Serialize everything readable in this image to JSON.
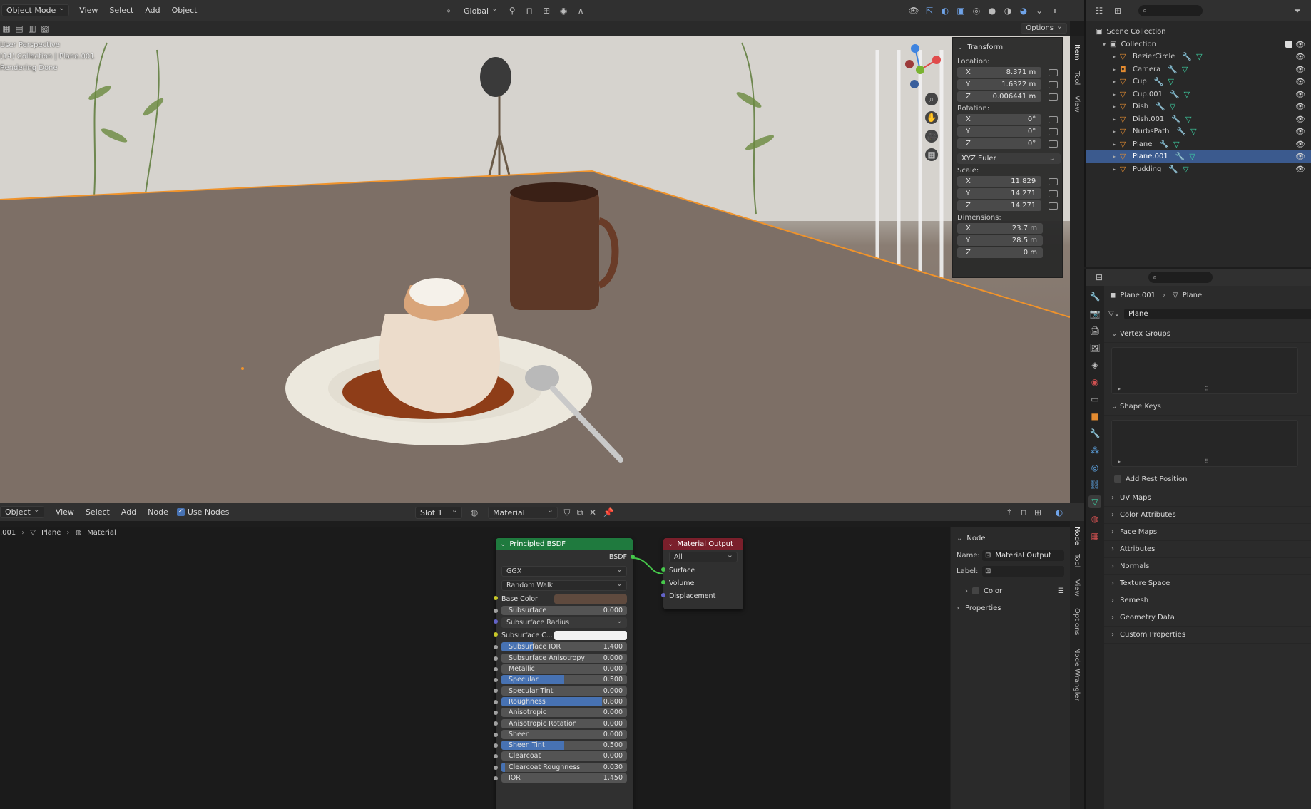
{
  "top_header": {
    "mode": "Object Mode",
    "menus": [
      "View",
      "Select",
      "Add",
      "Object"
    ],
    "orientation": "Global"
  },
  "viewport": {
    "options_label": "Options",
    "overlay_lines": [
      "User Perspective",
      "(14) Collection | Plane.001",
      "Rendering Done"
    ]
  },
  "npanel": {
    "tabs": [
      "Item",
      "Tool",
      "View"
    ],
    "section": "Transform",
    "location_label": "Location:",
    "location": [
      {
        "axis": "X",
        "value": "8.371 m"
      },
      {
        "axis": "Y",
        "value": "1.6322 m"
      },
      {
        "axis": "Z",
        "value": "0.006441 m"
      }
    ],
    "rotation_label": "Rotation:",
    "rotation": [
      {
        "axis": "X",
        "value": "0°"
      },
      {
        "axis": "Y",
        "value": "0°"
      },
      {
        "axis": "Z",
        "value": "0°"
      }
    ],
    "rotation_mode": "XYZ Euler",
    "scale_label": "Scale:",
    "scale": [
      {
        "axis": "X",
        "value": "11.829"
      },
      {
        "axis": "Y",
        "value": "14.271"
      },
      {
        "axis": "Z",
        "value": "14.271"
      }
    ],
    "dimensions_label": "Dimensions:",
    "dimensions": [
      {
        "axis": "X",
        "value": "23.7 m"
      },
      {
        "axis": "Y",
        "value": "28.5 m"
      },
      {
        "axis": "Z",
        "value": "0 m"
      }
    ]
  },
  "outliner": {
    "scene_collection": "Scene Collection",
    "collection": "Collection",
    "items": [
      {
        "name": "BezierCircle",
        "selected": false
      },
      {
        "name": "Camera",
        "selected": false
      },
      {
        "name": "Cup",
        "selected": false
      },
      {
        "name": "Cup.001",
        "selected": false
      },
      {
        "name": "Dish",
        "selected": false
      },
      {
        "name": "Dish.001",
        "selected": false
      },
      {
        "name": "NurbsPath",
        "selected": false
      },
      {
        "name": "Plane",
        "selected": false
      },
      {
        "name": "Plane.001",
        "selected": true
      },
      {
        "name": "Pudding",
        "selected": false
      }
    ]
  },
  "properties": {
    "breadcrumb_object": "Plane.001",
    "breadcrumb_data": "Plane",
    "mesh_name": "Plane",
    "sections": {
      "vertex_groups": "Vertex Groups",
      "shape_keys": "Shape Keys",
      "add_rest_position": "Add Rest Position",
      "collapsed": [
        "UV Maps",
        "Color Attributes",
        "Face Maps",
        "Attributes",
        "Normals",
        "Texture Space",
        "Remesh",
        "Geometry Data",
        "Custom Properties"
      ]
    }
  },
  "node_header": {
    "mode": "Object",
    "menus": [
      "View",
      "Select",
      "Add",
      "Node"
    ],
    "use_nodes": "Use Nodes",
    "slot": "Slot 1",
    "material": "Material",
    "breadcrumb": [
      ".001",
      "Plane",
      "Material"
    ]
  },
  "bsdf_node": {
    "title": "Principled BSDF",
    "output": "BSDF",
    "distribution": "GGX",
    "subsurface_method": "Random Walk",
    "base_color_label": "Base Color",
    "subsurface_radius": "Subsurface Radius",
    "subsurface_color_label": "Subsurface C...",
    "sliders": [
      {
        "label": "Subsurface",
        "value": "0.000",
        "fill": 0
      },
      {
        "label": "Subsurface IOR",
        "value": "1.400",
        "fill": 0.25
      },
      {
        "label": "Subsurface Anisotropy",
        "value": "0.000",
        "fill": 0
      },
      {
        "label": "Metallic",
        "value": "0.000",
        "fill": 0
      },
      {
        "label": "Specular",
        "value": "0.500",
        "fill": 0.5
      },
      {
        "label": "Specular Tint",
        "value": "0.000",
        "fill": 0
      },
      {
        "label": "Roughness",
        "value": "0.800",
        "fill": 0.8
      },
      {
        "label": "Anisotropic",
        "value": "0.000",
        "fill": 0
      },
      {
        "label": "Anisotropic Rotation",
        "value": "0.000",
        "fill": 0
      },
      {
        "label": "Sheen",
        "value": "0.000",
        "fill": 0
      },
      {
        "label": "Sheen Tint",
        "value": "0.500",
        "fill": 0.5
      },
      {
        "label": "Clearcoat",
        "value": "0.000",
        "fill": 0
      },
      {
        "label": "Clearcoat Roughness",
        "value": "0.030",
        "fill": 0.03
      },
      {
        "label": "IOR",
        "value": "1.450",
        "fill": 0
      }
    ]
  },
  "output_node": {
    "title": "Material Output",
    "target": "All",
    "inputs": [
      "Surface",
      "Volume",
      "Displacement"
    ]
  },
  "node_sidebar": {
    "tabs": [
      "Node",
      "Tool",
      "View",
      "Options",
      "Node Wrangler"
    ],
    "section": "Node",
    "name_label": "Name:",
    "name_value": "Material Output",
    "label_label": "Label:",
    "label_value": "",
    "color_label": "Color",
    "properties_label": "Properties"
  },
  "colors": {
    "accent": "#4772b3",
    "selection": "#3b5a8e",
    "bsdf_header": "#1f7a3e",
    "output_header": "#7a1f2b",
    "object_icon": "#e38b30",
    "mesh_icon": "#3ed2a4"
  }
}
